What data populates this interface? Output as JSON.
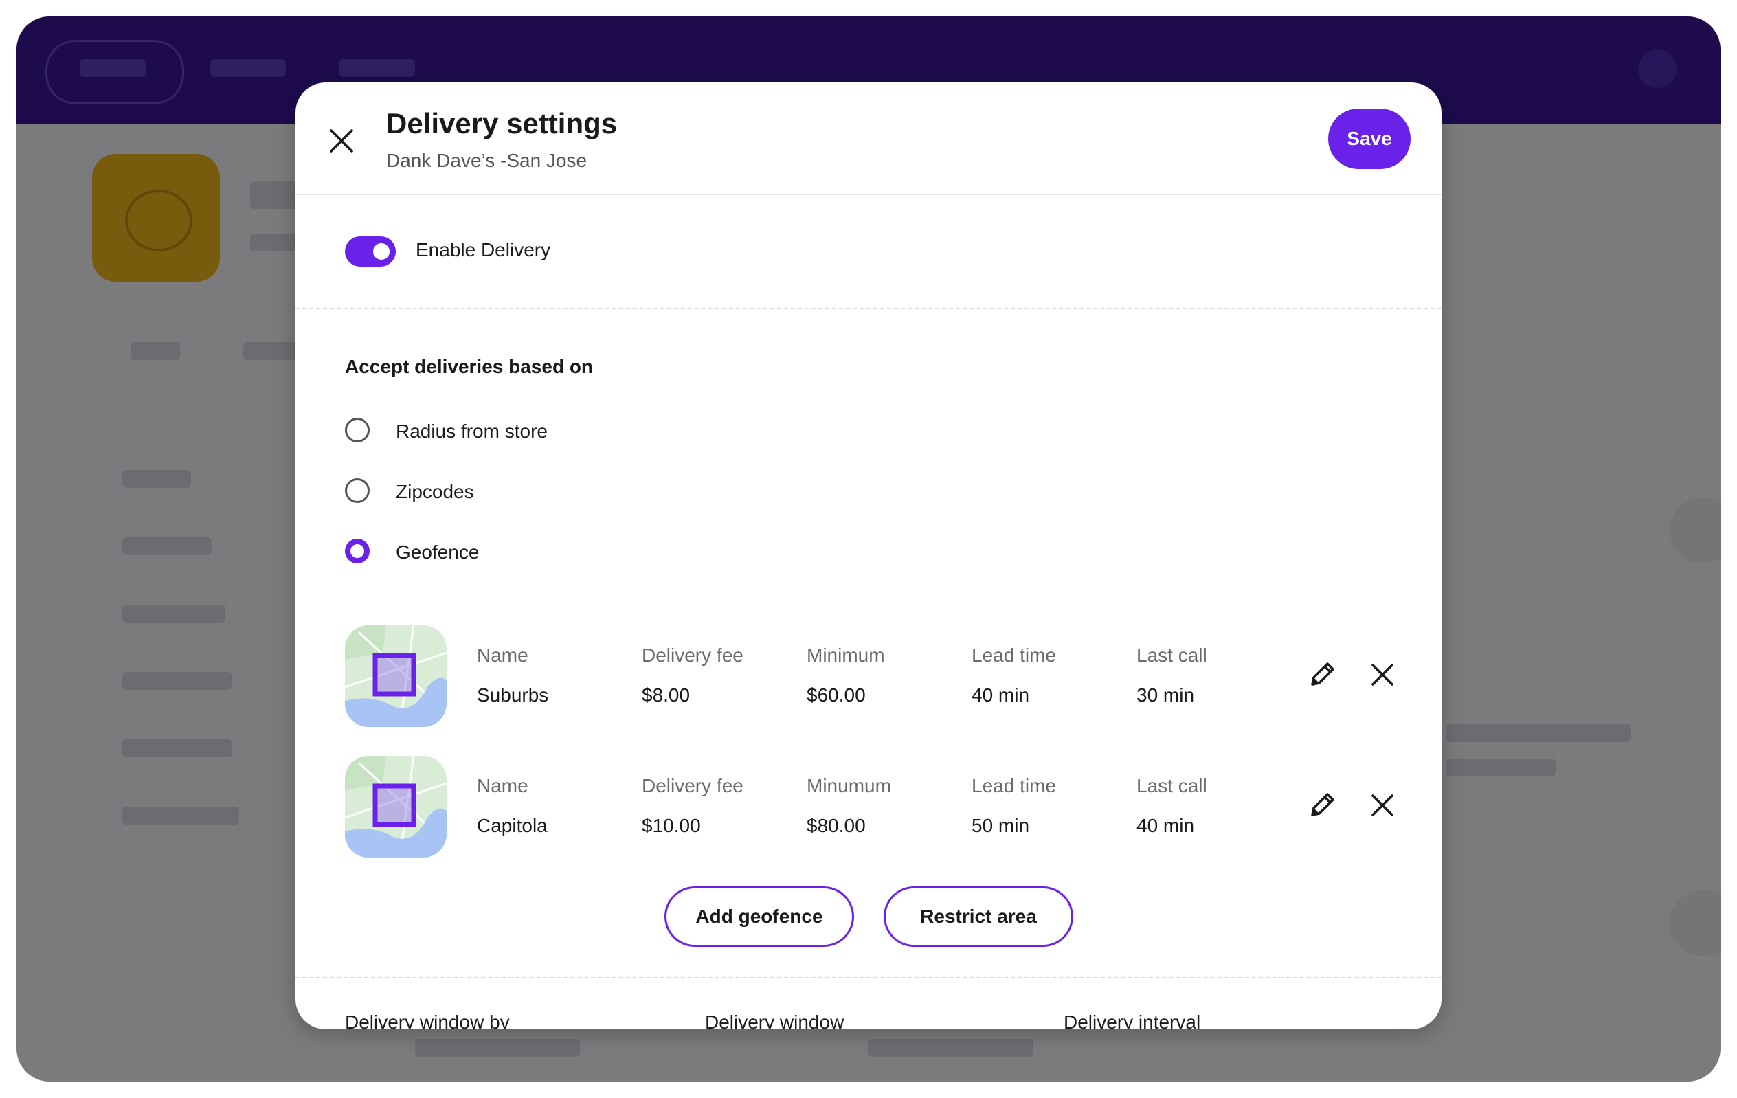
{
  "modal": {
    "title": "Delivery settings",
    "subtitle": "Dank Dave’s -San Jose",
    "save_label": "Save",
    "close_icon": "close-icon"
  },
  "delivery": {
    "enabled": true,
    "toggle_label": "Enable Delivery"
  },
  "accept_based_on": {
    "title": "Accept deliveries based on",
    "options": [
      {
        "label": "Radius from store",
        "selected": false
      },
      {
        "label": "Zipcodes",
        "selected": false
      },
      {
        "label": "Geofence",
        "selected": true
      }
    ]
  },
  "geofences": [
    {
      "name_label": "Name",
      "name": "Suburbs",
      "fee_label": "Delivery fee",
      "fee": "$8.00",
      "min_label": "Minimum",
      "min": "$60.00",
      "lead_label": "Lead time",
      "lead": "40 min",
      "last_label": "Last call",
      "last": "30 min"
    },
    {
      "name_label": "Name",
      "name": "Capitola",
      "fee_label": "Delivery fee",
      "fee": "$10.00",
      "min_label": "Minumum",
      "min": "$80.00",
      "lead_label": "Lead time",
      "lead": "50 min",
      "last_label": "Last call",
      "last": "40 min"
    }
  ],
  "actions": {
    "add_geofence": "Add geofence",
    "restrict_area": "Restrict area"
  },
  "delivery_window": {
    "by_label": "Delivery window by",
    "window_label": "Delivery window",
    "interval_label": "Delivery interval"
  },
  "colors": {
    "accent": "#6a22ea",
    "topbar": "#3a1699",
    "map_water": "#a7c4f4",
    "map_land": "#d8ecd6"
  }
}
